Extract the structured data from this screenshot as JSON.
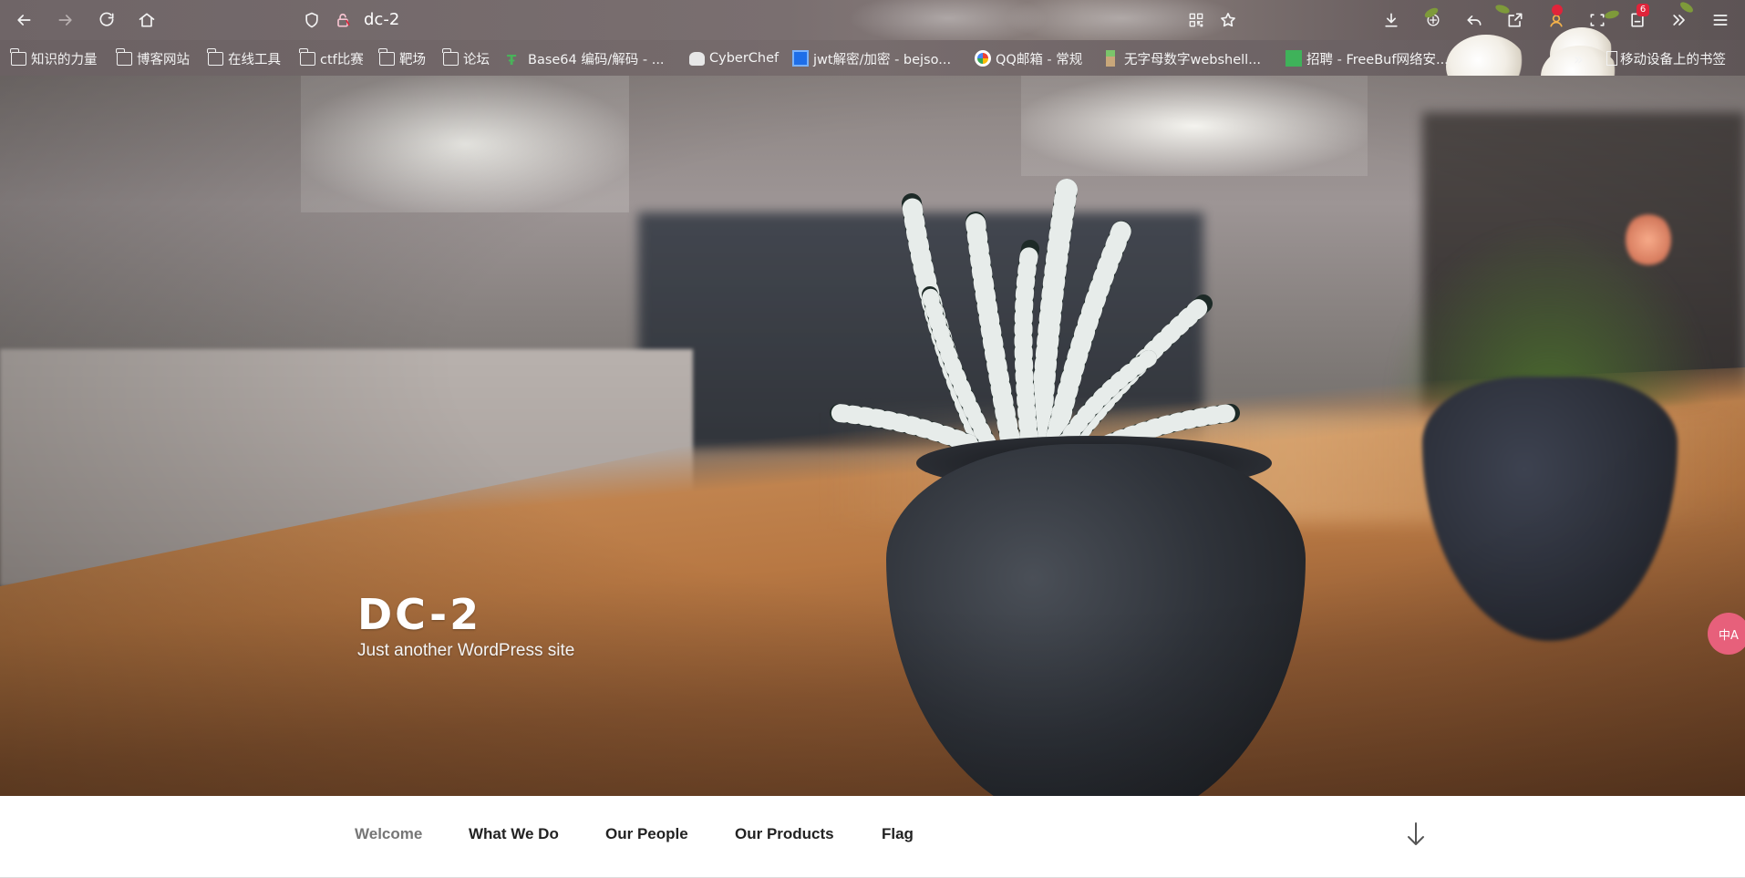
{
  "browser": {
    "url_title": "dc-2",
    "icons": [
      "back-icon",
      "forward-icon",
      "reload-icon",
      "home-icon",
      "shield-icon",
      "lock-icon",
      "qr-icon",
      "star-icon",
      "download-icon",
      "extension-icon",
      "undo-icon",
      "share-icon",
      "profile-icon",
      "screenshot-icon",
      "more-icon",
      "menu-icon"
    ],
    "badge_count": "6"
  },
  "bookmarks": [
    {
      "label": "知识的力量",
      "type": "folder"
    },
    {
      "label": "博客网站",
      "type": "folder"
    },
    {
      "label": "在线工具",
      "type": "folder"
    },
    {
      "label": "ctf比赛",
      "type": "folder"
    },
    {
      "label": "靶场",
      "type": "folder"
    },
    {
      "label": "论坛",
      "type": "folder"
    },
    {
      "label": "Base64 编码/解码 - ...",
      "type": "link"
    },
    {
      "label": "CyberChef",
      "type": "link"
    },
    {
      "label": "jwt解密/加密 - bejso...",
      "type": "link"
    },
    {
      "label": "QQ邮箱 - 常规",
      "type": "link"
    },
    {
      "label": "无字母数字webshell...",
      "type": "link"
    },
    {
      "label": "招聘 - FreeBuf网络安...",
      "type": "link"
    },
    {
      "label": "移动设备上的书签",
      "type": "folder"
    }
  ],
  "hero": {
    "title": "DC-2",
    "tagline": "Just another WordPress site"
  },
  "translate_button": "中A",
  "nav": {
    "items": [
      "Welcome",
      "What We Do",
      "Our People",
      "Our Products",
      "Flag"
    ],
    "current": "Welcome"
  },
  "colors": {
    "nav_current": "#767676",
    "nav_text": "#222222",
    "badge": "#e0243a",
    "translate": "#e7607b"
  }
}
